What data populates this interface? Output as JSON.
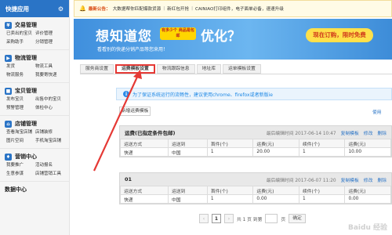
{
  "sidebar": {
    "title": "快捷应用",
    "sections": [
      {
        "title": "交易管理",
        "links": [
          "已卖出的宝贝",
          "评价管理",
          "采购助手",
          "分销管理"
        ]
      },
      {
        "title": "物流管理",
        "links": [
          "发货",
          "物流工具",
          "物流服务",
          "我要寄快递"
        ]
      },
      {
        "title": "宝贝管理",
        "links": [
          "发布宝贝",
          "出售中的宝贝",
          "预警管理",
          "体检中心"
        ]
      },
      {
        "title": "店铺管理",
        "links": [
          "查看淘宝店铺",
          "店铺装修",
          "图片空间",
          "手机淘宝店铺"
        ]
      },
      {
        "title": "营销中心",
        "links": [
          "我要推广",
          "活动报名",
          "生意参谋",
          "店铺营销工具"
        ]
      },
      {
        "title": "数据中心",
        "links": []
      }
    ]
  },
  "notice": {
    "label": "最新公告：",
    "items": [
      "大数据帮你匹配爆款货源",
      "新红包开抢",
      "CAINIAO打印组件，电子面单必备，速速升级"
    ]
  },
  "banner": {
    "title": "想知道您",
    "tag": "有多少个 商品是包邮",
    "title2": "优化？",
    "subtitle": "看看别的快递分销产品等您来用！",
    "cta": "现在订购，限时免费"
  },
  "tabs": [
    {
      "label": "服务商设置",
      "active": false
    },
    {
      "label": "运费模板设置",
      "active": true
    },
    {
      "label": "物流跟踪信息",
      "active": false
    },
    {
      "label": "地址库",
      "active": false
    },
    {
      "label": "运单模板设置",
      "active": false
    }
  ],
  "infobar": {
    "text": "为了保证系统运行的流畅性，建议使用chrome、firefox或者新版ie"
  },
  "new_template_button": "新增运费模板",
  "batch_link": "使用",
  "templates": [
    {
      "name": "运费(已指定条件包邮)",
      "last_edit": "最后编辑时间 2017-06-14 10:47",
      "actions": [
        "复制模板",
        "修改",
        "删除"
      ],
      "columns": [
        "运送方式",
        "运送到",
        "首件(个)",
        "运费(元)",
        "续件(个)",
        "运费(元)"
      ],
      "rows": [
        [
          "快递",
          "中国",
          "1",
          "20.00",
          "1",
          "10.00"
        ]
      ]
    },
    {
      "name": "01",
      "last_edit": "最后编辑时间 2017-06-07 11:20",
      "actions": [
        "复制模板",
        "修改",
        "删除"
      ],
      "columns": [
        "运送方式",
        "运送到",
        "首件(个)",
        "运费(元)",
        "续件(个)",
        "运费(元)"
      ],
      "rows": [
        [
          "快递",
          "中国",
          "1",
          "0.00",
          "1",
          "0.00"
        ]
      ]
    }
  ],
  "pager": {
    "prev": "‹",
    "current": "1",
    "next": "›",
    "total_text": "共 1 页 到第",
    "page_unit": "页",
    "confirm": "确定"
  },
  "watermark": "Baidu 经验",
  "colors": {
    "accent": "#2a74c6",
    "highlight": "#e53935",
    "banner": "#4a9ee6"
  }
}
